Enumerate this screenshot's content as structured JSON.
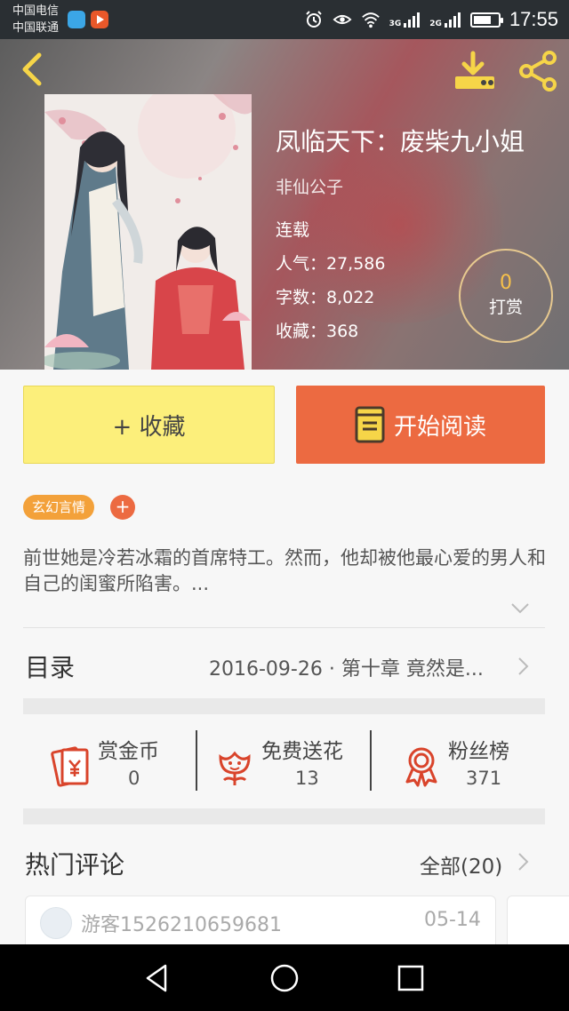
{
  "status_bar": {
    "carrier1": "中国电信",
    "carrier2": "中国联通",
    "net1": "3G",
    "net2": "2G",
    "battery_level": 0.75,
    "time": "17:55"
  },
  "book": {
    "title": "凤临天下：废柴九小姐",
    "author": "非仙公子",
    "status": "连载",
    "popularity": "人气：27,586",
    "word_count": "字数：8,022",
    "favorites": "收藏：368",
    "tip_count": "0",
    "tip_label": "打赏"
  },
  "actions": {
    "collect_label": "+ 收藏",
    "read_label": "开始阅读"
  },
  "tags": [
    {
      "label": "玄幻言情"
    }
  ],
  "tag_add_label": "+",
  "intro": "前世她是冷若冰霜的首席特工。然而，他却被他最心爱的男人和自己的闺蜜所陷害。...",
  "toc": {
    "label": "目录",
    "latest": "2016-09-26 · 第十章 竟然是..."
  },
  "stats": [
    {
      "label": "赏金币",
      "value": "0",
      "icon": "red-envelope-icon"
    },
    {
      "label": "免费送花",
      "value": "13",
      "icon": "flower-icon"
    },
    {
      "label": "粉丝榜",
      "value": "371",
      "icon": "ribbon-badge-icon"
    }
  ],
  "comments": {
    "title": "热门评论",
    "all_label": "全部(20)",
    "items": [
      {
        "user": "游客1526210659681",
        "date": "05-14"
      }
    ]
  },
  "colors": {
    "accent_orange": "#ec6a41",
    "collect_yellow": "#fcef7b",
    "tag_orange": "#f3a13a",
    "icon_red": "#d9442b"
  }
}
